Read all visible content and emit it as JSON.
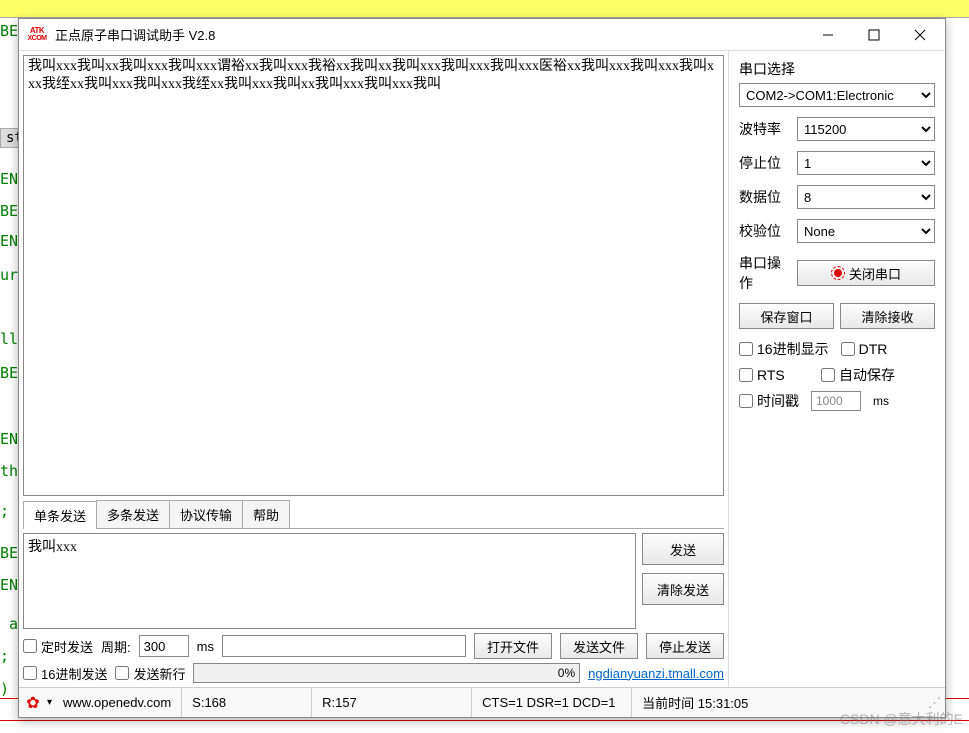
{
  "bg": {
    "strtok": "str",
    "lines": [
      "BE",
      "EN",
      "BE",
      "EN",
      "ur",
      "ll",
      "BE",
      "EN",
      "th",
      ";",
      "BE",
      "EN",
      " a",
      ";",
      ")"
    ]
  },
  "window": {
    "title": "正点原子串口调试助手 V2.8",
    "icon_line1": "ATK",
    "icon_line2": "XCOM"
  },
  "rx": {
    "text": "我叫xxx我叫xx我叫xxx我叫xxx谓裕xx我叫xxx我裕xx我叫xx我叫xxx我叫xxx我叫xxx医裕xx我叫xxx我叫xxx我叫xxx我绖xx我叫xxx我叫xxx我绖xx我叫xxx我叫xx我叫xxx我叫xxx我叫"
  },
  "tabs": {
    "single": "单条发送",
    "multi": "多条发送",
    "proto": "协议传输",
    "help": "帮助"
  },
  "tx": {
    "text": "我叫xxx",
    "send": "发送",
    "clear_send": "清除发送"
  },
  "controls": {
    "timed_send": "定时发送",
    "period_label": "周期:",
    "period_value": "300",
    "ms": "ms",
    "open_file": "打开文件",
    "send_file": "发送文件",
    "stop_send": "停止发送",
    "hex_send": "16进制发送",
    "send_newline": "发送新行",
    "progress": "0%",
    "shop_link": "ngdianyuanzi.tmall.com"
  },
  "port": {
    "section": "串口选择",
    "value": "COM2->COM1:Electronic",
    "baud_label": "波特率",
    "baud_value": "115200",
    "stop_label": "停止位",
    "stop_value": "1",
    "data_label": "数据位",
    "data_value": "8",
    "parity_label": "校验位",
    "parity_value": "None",
    "op_label": "串口操作",
    "close_btn": "关闭串口",
    "save_window": "保存窗口",
    "clear_rx": "清除接收",
    "hex_display": "16进制显示",
    "dtr": "DTR",
    "rts": "RTS",
    "autosave": "自动保存",
    "timestamp": "时间戳",
    "ts_value": "1000",
    "ts_ms": "ms"
  },
  "status": {
    "url": "www.openedv.com",
    "s": "S:168",
    "r": "R:157",
    "signals": "CTS=1 DSR=1 DCD=1",
    "time": "当前时间 15:31:05"
  },
  "watermark": "CSDN @意大利的E"
}
